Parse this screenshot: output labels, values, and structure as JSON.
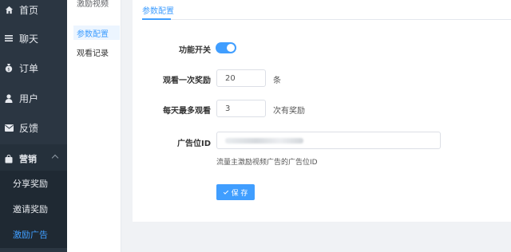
{
  "sidebar": {
    "items": [
      {
        "label": "首页",
        "icon": "home-icon"
      },
      {
        "label": "聊天",
        "icon": "menu-icon"
      },
      {
        "label": "订单",
        "icon": "money-icon"
      },
      {
        "label": "用户",
        "icon": "user-icon"
      },
      {
        "label": "反馈",
        "icon": "mail-icon"
      }
    ],
    "group": {
      "label": "营销",
      "icon": "bag-icon"
    },
    "sub_items": [
      {
        "label": "分享奖励"
      },
      {
        "label": "邀请奖励"
      },
      {
        "label": "激励广告"
      }
    ]
  },
  "submenu": {
    "title": "激励视频",
    "items": [
      {
        "label": "参数配置"
      },
      {
        "label": "观看记录"
      }
    ]
  },
  "main": {
    "tab": "参数配置",
    "form": {
      "switch_label": "功能开关",
      "switch_on": true,
      "reward_per_view_label": "观看一次奖励",
      "reward_per_view_value": "20",
      "reward_per_view_suffix": "条",
      "max_views_label": "每天最多观看",
      "max_views_value": "3",
      "max_views_suffix": "次有奖励",
      "ad_id_label": "广告位ID",
      "ad_id_hint": "流量主激励视频广告的广告位ID",
      "save_label": "保 存"
    }
  },
  "colors": {
    "accent": "#409eff",
    "sidebar_bg": "#2b3642"
  }
}
